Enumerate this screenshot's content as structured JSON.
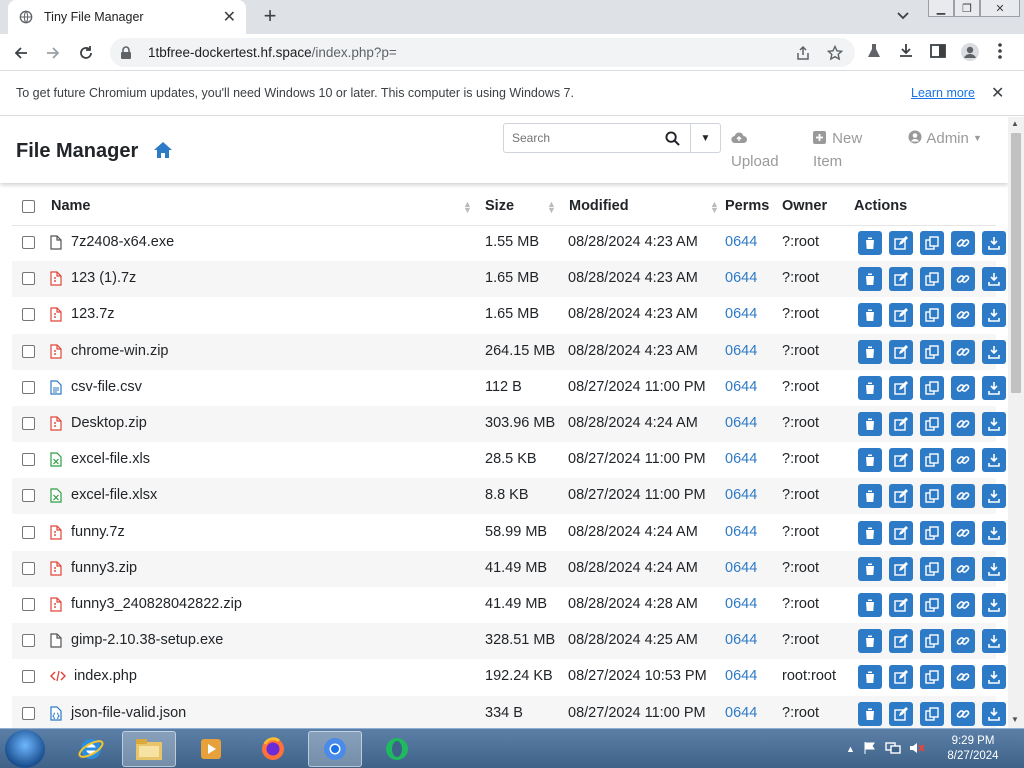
{
  "browser": {
    "tab_title": "Tiny File Manager",
    "url_host": "1tbfree-dockertest.hf.space",
    "url_path": "/index.php?p=",
    "infobar_message": "To get future Chromium updates, you'll need Windows 10 or later. This computer is using Windows 7.",
    "infobar_link": "Learn more"
  },
  "app": {
    "brand": "File Manager",
    "search_placeholder": "Search",
    "upload_label": "Upload",
    "new_item_line1": "New",
    "new_item_line2": "Item",
    "user_label": "Admin"
  },
  "table": {
    "columns": [
      "Name",
      "Size",
      "Modified",
      "Perms",
      "Owner",
      "Actions"
    ],
    "rows": [
      {
        "name": "7z2408-x64.exe",
        "icon": "file-icon",
        "size": "1.55 MB",
        "modified": "08/28/2024 4:23 AM",
        "perms": "0644",
        "owner": "?:root"
      },
      {
        "name": "123 (1).7z",
        "icon": "archive-icon",
        "size": "1.65 MB",
        "modified": "08/28/2024 4:23 AM",
        "perms": "0644",
        "owner": "?:root"
      },
      {
        "name": "123.7z",
        "icon": "archive-icon",
        "size": "1.65 MB",
        "modified": "08/28/2024 4:23 AM",
        "perms": "0644",
        "owner": "?:root"
      },
      {
        "name": "chrome-win.zip",
        "icon": "archive-icon",
        "size": "264.15 MB",
        "modified": "08/28/2024 4:23 AM",
        "perms": "0644",
        "owner": "?:root"
      },
      {
        "name": "csv-file.csv",
        "icon": "text-file-icon",
        "size": "112 B",
        "modified": "08/27/2024 11:00 PM",
        "perms": "0644",
        "owner": "?:root"
      },
      {
        "name": "Desktop.zip",
        "icon": "archive-icon",
        "size": "303.96 MB",
        "modified": "08/28/2024 4:24 AM",
        "perms": "0644",
        "owner": "?:root"
      },
      {
        "name": "excel-file.xls",
        "icon": "excel-icon",
        "size": "28.5 KB",
        "modified": "08/27/2024 11:00 PM",
        "perms": "0644",
        "owner": "?:root"
      },
      {
        "name": "excel-file.xlsx",
        "icon": "excel-icon",
        "size": "8.8 KB",
        "modified": "08/27/2024 11:00 PM",
        "perms": "0644",
        "owner": "?:root"
      },
      {
        "name": "funny.7z",
        "icon": "archive-icon",
        "size": "58.99 MB",
        "modified": "08/28/2024 4:24 AM",
        "perms": "0644",
        "owner": "?:root"
      },
      {
        "name": "funny3.zip",
        "icon": "archive-icon",
        "size": "41.49 MB",
        "modified": "08/28/2024 4:24 AM",
        "perms": "0644",
        "owner": "?:root"
      },
      {
        "name": "funny3_240828042822.zip",
        "icon": "archive-icon",
        "size": "41.49 MB",
        "modified": "08/28/2024 4:28 AM",
        "perms": "0644",
        "owner": "?:root"
      },
      {
        "name": "gimp-2.10.38-setup.exe",
        "icon": "file-icon",
        "size": "328.51 MB",
        "modified": "08/28/2024 4:25 AM",
        "perms": "0644",
        "owner": "?:root"
      },
      {
        "name": "index.php",
        "icon": "code-icon",
        "size": "192.24 KB",
        "modified": "08/27/2024 10:53 PM",
        "perms": "0644",
        "owner": "root:root"
      },
      {
        "name": "json-file-valid.json",
        "icon": "json-file-icon",
        "size": "334 B",
        "modified": "08/27/2024 11:00 PM",
        "perms": "0644",
        "owner": "?:root"
      }
    ]
  },
  "taskbar": {
    "time": "9:29 PM",
    "date": "8/27/2024"
  },
  "colors": {
    "accent": "#2d7ac6",
    "archive": "#e0453a",
    "excel": "#2e9e45"
  }
}
